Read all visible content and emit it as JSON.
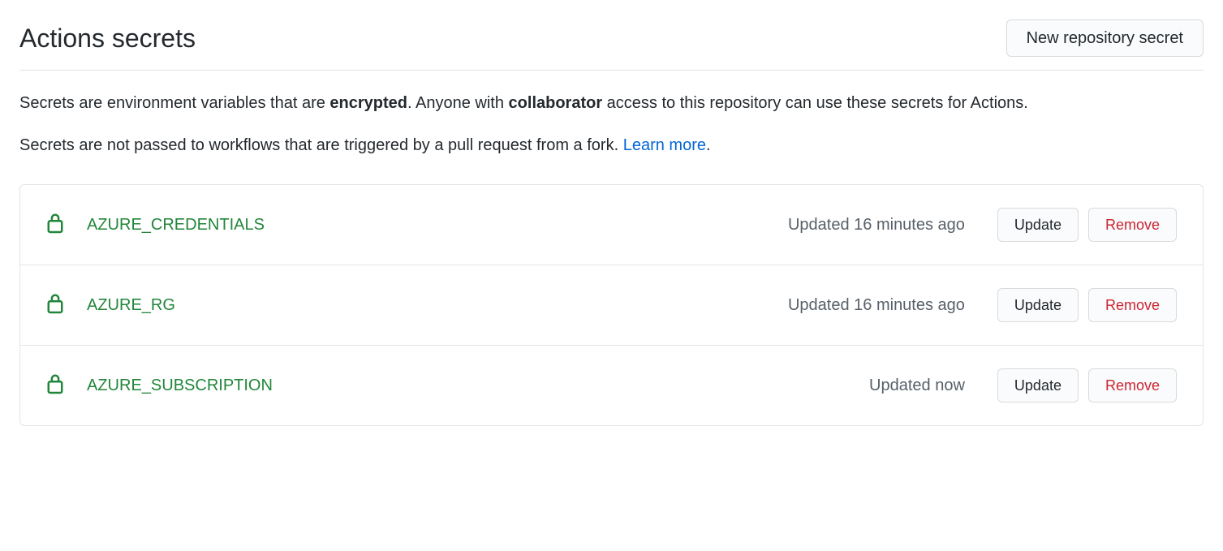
{
  "header": {
    "title": "Actions secrets",
    "new_button": "New repository secret"
  },
  "description": {
    "p1_prefix": "Secrets are environment variables that are ",
    "p1_bold1": "encrypted",
    "p1_mid": ". Anyone with ",
    "p1_bold2": "collaborator",
    "p1_suffix": " access to this repository can use these secrets for Actions.",
    "p2_text": "Secrets are not passed to workflows that are triggered by a pull request from a fork. ",
    "p2_link": "Learn more",
    "p2_suffix": "."
  },
  "secrets": [
    {
      "name": "AZURE_CREDENTIALS",
      "updated": "Updated 16 minutes ago"
    },
    {
      "name": "AZURE_RG",
      "updated": "Updated 16 minutes ago"
    },
    {
      "name": "AZURE_SUBSCRIPTION",
      "updated": "Updated now"
    }
  ],
  "buttons": {
    "update": "Update",
    "remove": "Remove"
  }
}
